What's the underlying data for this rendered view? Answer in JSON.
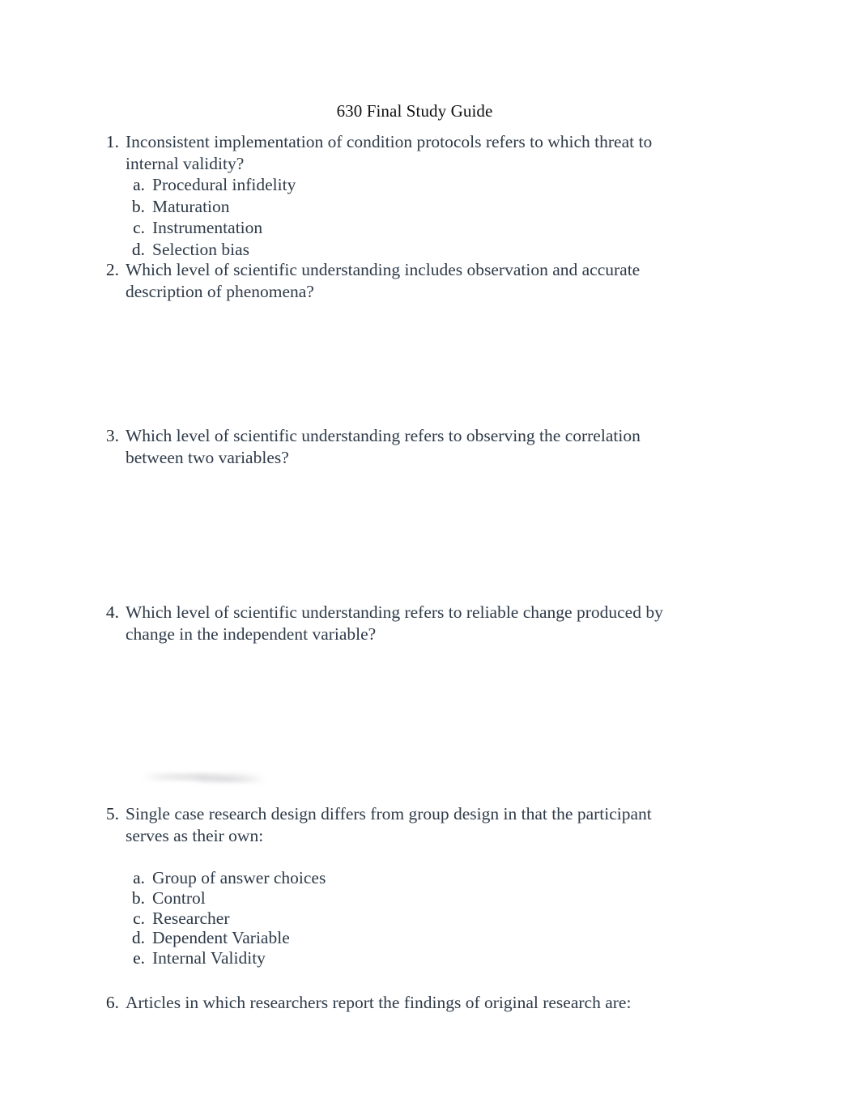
{
  "document": {
    "title": "630 Final Study Guide",
    "background_color": "#ffffff",
    "text_color": "#2f3b49",
    "title_color": "#101010"
  },
  "questions": [
    {
      "number": "1.",
      "text": "Inconsistent implementation of condition protocols refers to which threat to internal validity?",
      "options": [
        {
          "marker": "a.",
          "text": "Procedural infidelity"
        },
        {
          "marker": "b.",
          "text": "Maturation"
        },
        {
          "marker": "c.",
          "text": "Instrumentation"
        },
        {
          "marker": "d.",
          "text": "Selection bias"
        }
      ]
    },
    {
      "number": "2.",
      "text": "Which level of scientific understanding includes observation and accurate description of phenomena?",
      "options": []
    },
    {
      "number": "3.",
      "text": "Which level of scientific understanding refers to observing the correlation between two variables?",
      "options": []
    },
    {
      "number": "4.",
      "text": "Which level of scientific understanding refers to reliable change produced by change in the independent variable?",
      "options": []
    },
    {
      "number": "5.",
      "text": "Single case research design differs from group design in that the participant serves as their own:",
      "options": [
        {
          "marker": "a.",
          "text": "Group of answer choices"
        },
        {
          "marker": "b.",
          "text": "Control"
        },
        {
          "marker": "c.",
          "text": "Researcher"
        },
        {
          "marker": "d.",
          "text": "Dependent Variable"
        },
        {
          "marker": "e.",
          "text": "Internal Validity"
        }
      ]
    },
    {
      "number": "6.",
      "text": "Articles in which researchers report the findings of original research are:",
      "options": []
    }
  ]
}
